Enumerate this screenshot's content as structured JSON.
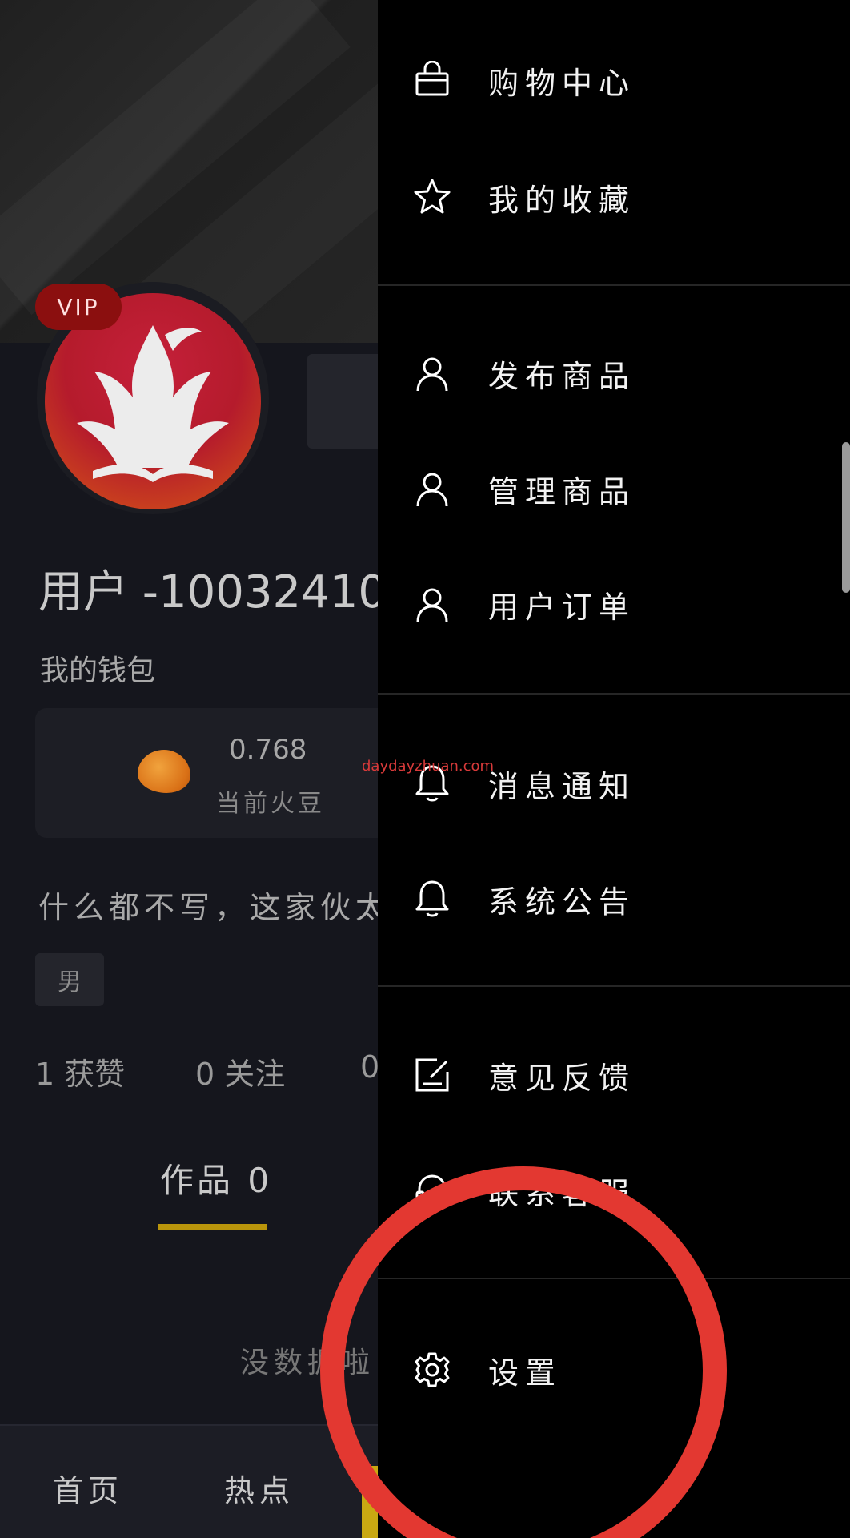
{
  "profile": {
    "vip_badge": "VIP",
    "username": "用户 -10032410",
    "wallet_label": "我的钱包",
    "bean_value": "0.768",
    "bean_label": "当前火豆",
    "bio": "什么都不写，这家伙太",
    "gender": "男",
    "stats": {
      "likes": "1 获赞",
      "following": "0 关注",
      "fans_partial": "0"
    },
    "works_tab": "作品 0",
    "empty_text": "没数据啦",
    "accent_color": "#b9950b"
  },
  "bottom_nav": {
    "items": [
      {
        "label": "首页"
      },
      {
        "label": "热点"
      }
    ]
  },
  "drawer": {
    "groups": [
      {
        "items": [
          {
            "label": "购物中心",
            "icon": "shopping-bag-icon"
          },
          {
            "label": "我的收藏",
            "icon": "star-icon"
          }
        ]
      },
      {
        "items": [
          {
            "label": "发布商品",
            "icon": "user-icon"
          },
          {
            "label": "管理商品",
            "icon": "user-icon"
          },
          {
            "label": "用户订单",
            "icon": "user-icon"
          }
        ]
      },
      {
        "items": [
          {
            "label": "消息通知",
            "icon": "bell-icon"
          },
          {
            "label": "系统公告",
            "icon": "bell-icon"
          }
        ]
      },
      {
        "items": [
          {
            "label": "意见反馈",
            "icon": "feedback-edit-icon"
          },
          {
            "label": "联系客服",
            "icon": "headset-icon"
          }
        ]
      },
      {
        "items": [
          {
            "label": "设置",
            "icon": "gear-icon"
          }
        ]
      }
    ]
  },
  "watermark": "daydayzhuan.com",
  "annotation_color": "#e33831"
}
